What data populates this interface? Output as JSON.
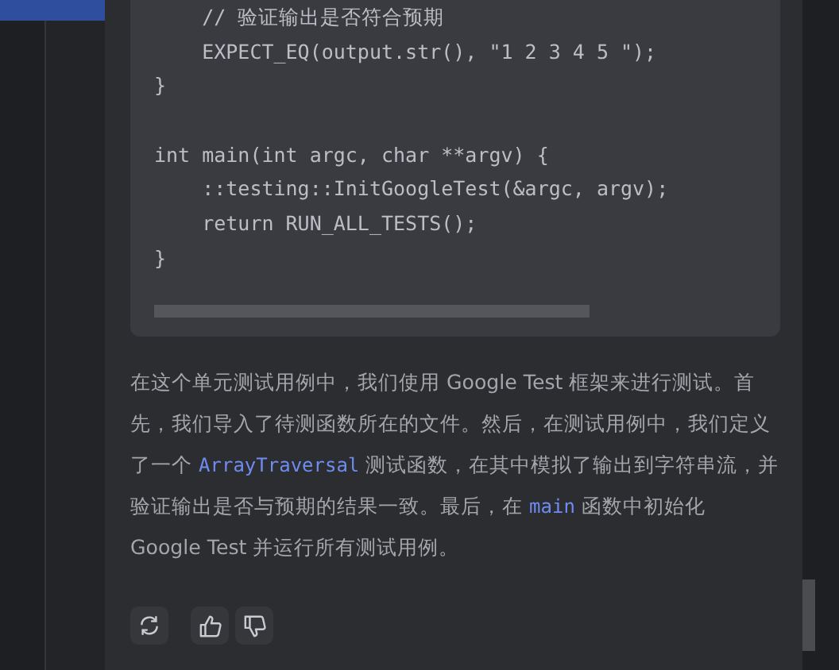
{
  "sidebar": {
    "items": [
      {
        "selected": true
      }
    ]
  },
  "code_block": {
    "lines": [
      {
        "kind": "line",
        "text": "    // 验证输出是否符合预期"
      },
      {
        "kind": "line",
        "text": "    EXPECT_EQ(output.str(), \"1 2 3 4 5 \");"
      },
      {
        "kind": "line",
        "text": "}"
      },
      {
        "kind": "blank"
      },
      {
        "kind": "line",
        "text": "int main(int argc, char **argv) {"
      },
      {
        "kind": "line",
        "text": "    ::testing::InitGoogleTest(&argc, argv);"
      },
      {
        "kind": "line",
        "text": "    return RUN_ALL_TESTS();"
      },
      {
        "kind": "line",
        "text": "}"
      }
    ]
  },
  "answer": {
    "paragraph": [
      {
        "kind": "text",
        "text": "在这个单元测试用例中，我们使用 Google Test 框架来进行测试。首先，我们导入了待测函数所在的文件。然后，在测试用例中，我们定义了一个 "
      },
      {
        "kind": "code",
        "text": "ArrayTraversal"
      },
      {
        "kind": "text",
        "text": " 测试函数，在其中模拟了输出到字符串流，并验证输出是否与预期的结果一致。最后，在 "
      },
      {
        "kind": "code",
        "text": "main"
      },
      {
        "kind": "text",
        "text": " 函数中初始化 Google Test 并运行所有测试用例。"
      }
    ]
  },
  "actions": [
    {
      "kind": "regenerate"
    },
    {
      "kind": "like"
    },
    {
      "kind": "dislike"
    }
  ]
}
